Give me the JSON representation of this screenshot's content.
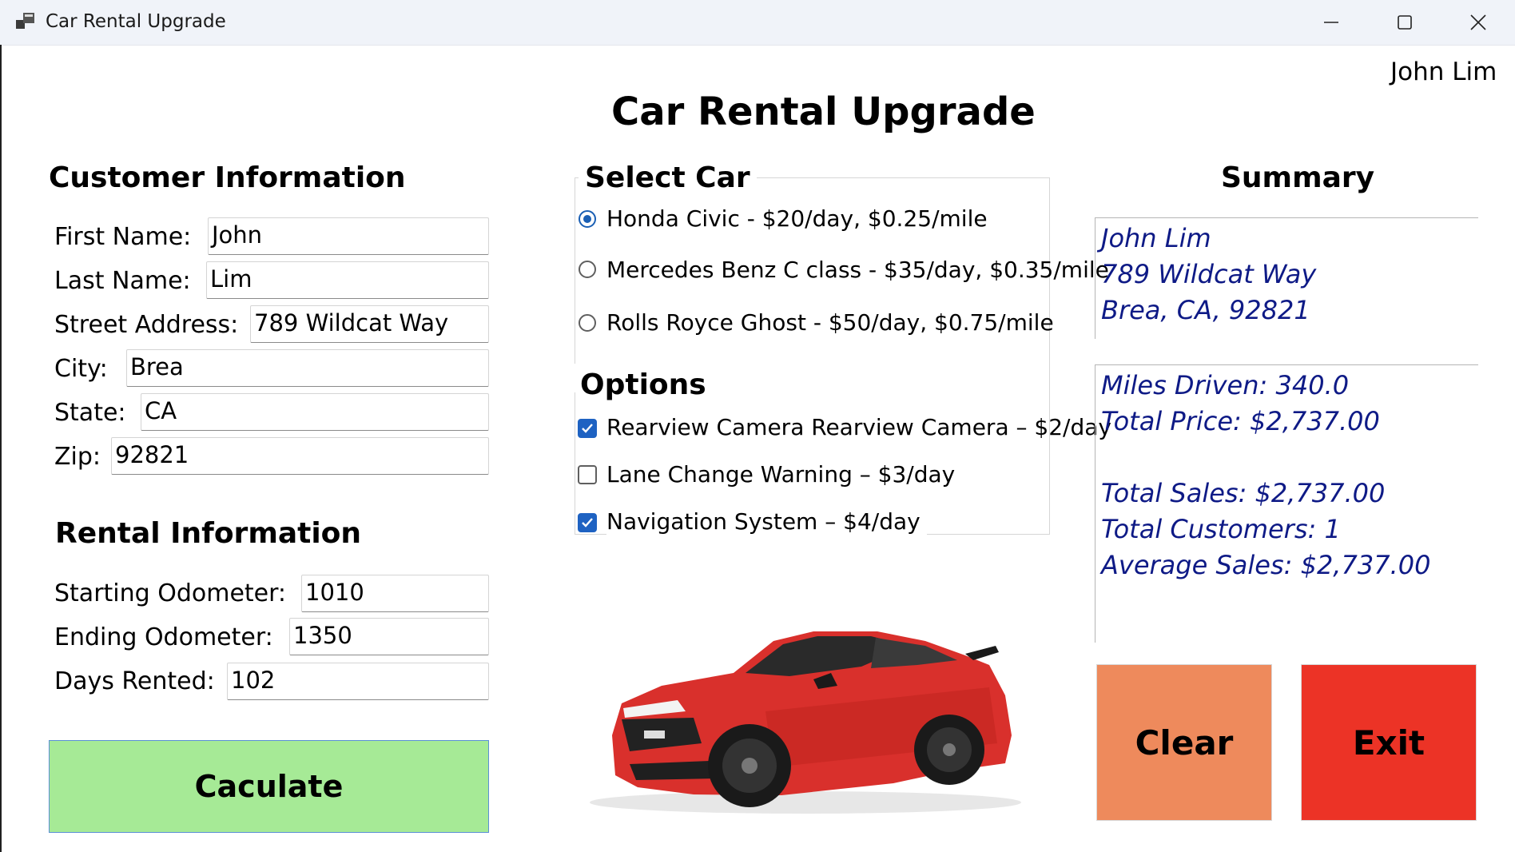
{
  "window": {
    "title": "Car Rental Upgrade",
    "user_name": "John Lim"
  },
  "page_title": "Car Rental Upgrade",
  "customer": {
    "heading": "Customer Information",
    "first_name_label": "First Name:",
    "first_name_value": "John",
    "last_name_label": "Last Name:",
    "last_name_value": "Lim",
    "street_label": "Street Address:",
    "street_value": "789 Wildcat Way",
    "city_label": "City:",
    "city_value": "Brea",
    "state_label": "State:",
    "state_value": "CA",
    "zip_label": "Zip:",
    "zip_value": "92821"
  },
  "rental": {
    "heading": "Rental Information",
    "start_label": "Starting Odometer:",
    "start_value": "1010",
    "end_label": "Ending Odometer:",
    "end_value": "1350",
    "days_label": "Days Rented:",
    "days_value": "102"
  },
  "calculate_label": "Caculate",
  "select_car": {
    "heading": "Select Car",
    "cars": [
      {
        "label": "Honda Civic - $20/day, $0.25/mile",
        "selected": true
      },
      {
        "label": "Mercedes Benz C class - $35/day, $0.35/mile",
        "selected": false
      },
      {
        "label": "Rolls Royce Ghost - $50/day, $0.75/mile",
        "selected": false
      }
    ]
  },
  "options": {
    "heading": "Options",
    "items": [
      {
        "label": "Rearview Camera Rearview Camera – $2/day",
        "checked": true
      },
      {
        "label": "Lane Change Warning – $3/day",
        "checked": false
      },
      {
        "label": "Navigation System – $4/day",
        "checked": true
      }
    ]
  },
  "summary": {
    "heading": "Summary",
    "name": "John Lim",
    "street": "789 Wildcat Way",
    "city_state_zip": "Brea, CA, 92821",
    "miles": "Miles Driven: 340.0",
    "total_price": "Total Price: $2,737.00",
    "total_sales": "Total Sales: $2,737.00",
    "total_customers": "Total Customers: 1",
    "average_sales": "Average Sales: $2,737.00"
  },
  "buttons": {
    "clear_label": "Clear",
    "exit_label": "Exit"
  },
  "colors": {
    "calculate_bg": "#a6ea96",
    "clear_bg": "#ee8a5c",
    "exit_bg": "#ec3326",
    "summary_text": "#0e1a86",
    "car_red": "#d9302c"
  }
}
